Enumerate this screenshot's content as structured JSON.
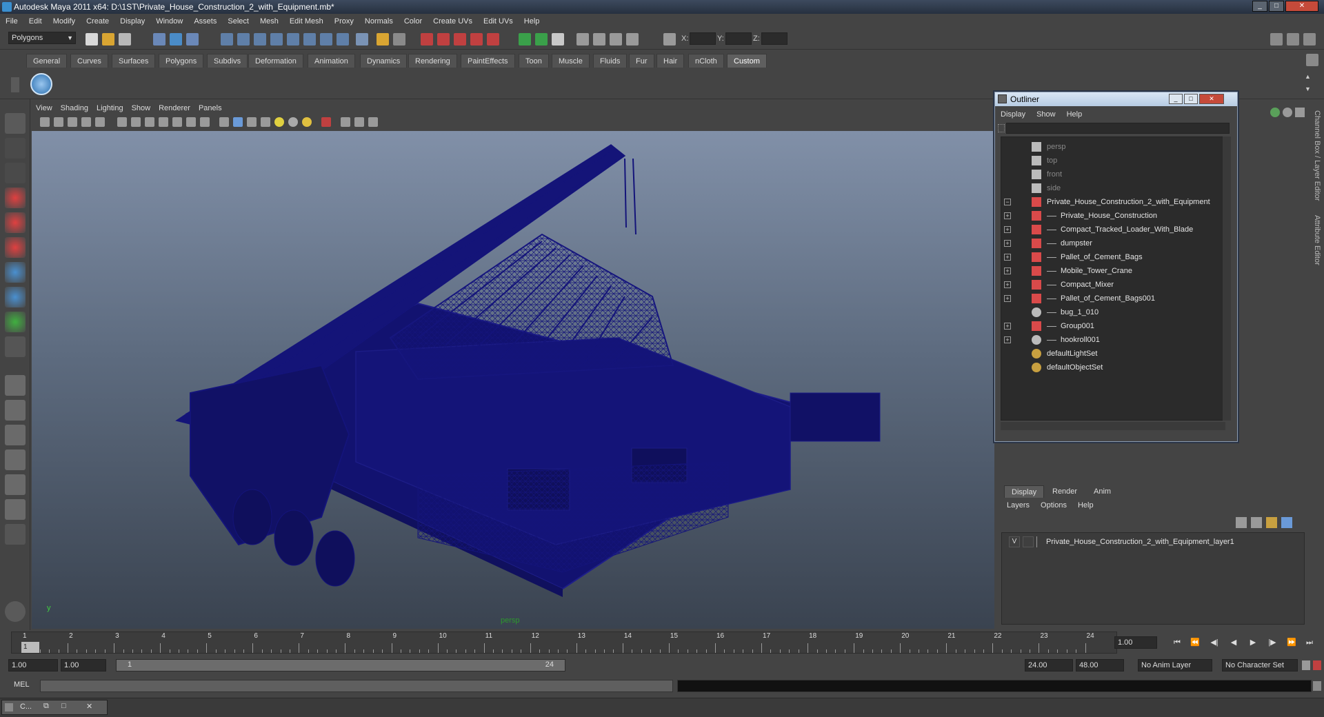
{
  "window": {
    "title": "Autodesk Maya 2011 x64: D:\\1ST\\Private_House_Construction_2_with_Equipment.mb*"
  },
  "menubar": [
    "File",
    "Edit",
    "Modify",
    "Create",
    "Display",
    "Window",
    "Assets",
    "Select",
    "Mesh",
    "Edit Mesh",
    "Proxy",
    "Normals",
    "Color",
    "Create UVs",
    "Edit UVs",
    "Help"
  ],
  "statusline": {
    "mode": "Polygons",
    "x_label": "X:",
    "y_label": "Y:",
    "z_label": "Z:"
  },
  "shelf_tabs": [
    "General",
    "Curves",
    "Surfaces",
    "Polygons",
    "Subdivs",
    "Deformation",
    "Animation",
    "Dynamics",
    "Rendering",
    "PaintEffects",
    "Toon",
    "Muscle",
    "Fluids",
    "Fur",
    "Hair",
    "nCloth",
    "Custom"
  ],
  "shelf_active": "Custom",
  "viewport": {
    "menu": [
      "View",
      "Shading",
      "Lighting",
      "Show",
      "Renderer",
      "Panels"
    ],
    "camera_label": "persp",
    "axis_label": "y",
    "wire_color": "#14147a"
  },
  "outliner": {
    "title": "Outliner",
    "menu": [
      "Display",
      "Show",
      "Help"
    ],
    "rows": [
      {
        "label": "persp",
        "type": "camera",
        "indent": 0,
        "dim": true,
        "expand": ""
      },
      {
        "label": "top",
        "type": "camera",
        "indent": 0,
        "dim": true,
        "expand": ""
      },
      {
        "label": "front",
        "type": "camera",
        "indent": 0,
        "dim": true,
        "expand": ""
      },
      {
        "label": "side",
        "type": "camera",
        "indent": 0,
        "dim": true,
        "expand": ""
      },
      {
        "label": "Private_House_Construction_2_with_Equipment",
        "type": "group",
        "indent": 0,
        "dim": false,
        "expand": "−"
      },
      {
        "label": "Private_House_Construction",
        "type": "group",
        "indent": 1,
        "dim": false,
        "expand": "+"
      },
      {
        "label": "Compact_Tracked_Loader_With_Blade",
        "type": "group",
        "indent": 1,
        "dim": false,
        "expand": "+"
      },
      {
        "label": "dumpster",
        "type": "group",
        "indent": 1,
        "dim": false,
        "expand": "+"
      },
      {
        "label": "Pallet_of_Cement_Bags",
        "type": "group",
        "indent": 1,
        "dim": false,
        "expand": "+"
      },
      {
        "label": "Mobile_Tower_Crane",
        "type": "group",
        "indent": 1,
        "dim": false,
        "expand": "+"
      },
      {
        "label": "Compact_Mixer",
        "type": "group",
        "indent": 1,
        "dim": false,
        "expand": "+"
      },
      {
        "label": "Pallet_of_Cement_Bags001",
        "type": "group",
        "indent": 1,
        "dim": false,
        "expand": "+"
      },
      {
        "label": "bug_1_010",
        "type": "joint",
        "indent": 1,
        "dim": false,
        "expand": ""
      },
      {
        "label": "Group001",
        "type": "group",
        "indent": 1,
        "dim": false,
        "expand": "+"
      },
      {
        "label": "hookroll001",
        "type": "joint",
        "indent": 1,
        "dim": false,
        "expand": "+"
      },
      {
        "label": "defaultLightSet",
        "type": "set",
        "indent": 0,
        "dim": false,
        "expand": ""
      },
      {
        "label": "defaultObjectSet",
        "type": "set",
        "indent": 0,
        "dim": false,
        "expand": ""
      }
    ]
  },
  "side_tabs": {
    "channel_box": "Channel Box / Layer Editor",
    "attribute_editor": "Attribute Editor"
  },
  "layer_editor": {
    "tabs": [
      "Display",
      "Render",
      "Anim"
    ],
    "active_tab": "Display",
    "menu": [
      "Layers",
      "Options",
      "Help"
    ],
    "layers": [
      {
        "visible": "V",
        "name": "Private_House_Construction_2_with_Equipment_layer1"
      }
    ]
  },
  "timeline": {
    "start": 1,
    "end": 24,
    "ticks": [
      "1",
      "2",
      "3",
      "4",
      "5",
      "6",
      "7",
      "8",
      "9",
      "10",
      "11",
      "12",
      "13",
      "14",
      "15",
      "16",
      "17",
      "18",
      "19",
      "20",
      "21",
      "22",
      "23",
      "24"
    ],
    "current_frame_marker": "1",
    "current_frame": "1.00"
  },
  "range": {
    "start_time": "1.00",
    "playback_start": "1.00",
    "range_start_label": "1",
    "range_end_label": "24",
    "playback_end": "24.00",
    "end_time": "48.00",
    "anim_layer": "No Anim Layer",
    "character_set": "No Character Set"
  },
  "command_line": {
    "label": "MEL"
  },
  "taskbar": {
    "mini_label": "C..."
  }
}
